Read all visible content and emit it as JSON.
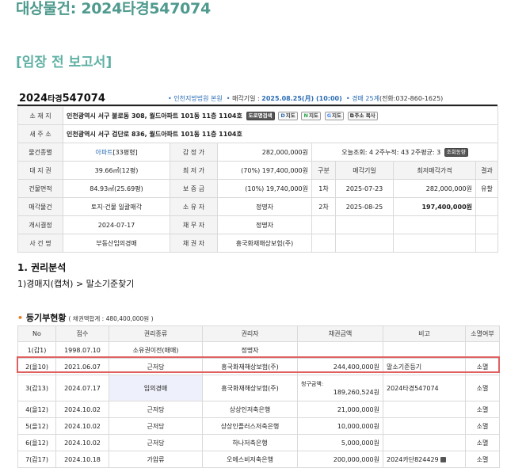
{
  "header": {
    "main_title": "대상물건: 2024타경547074",
    "report_title": "[임장 전 보고서]"
  },
  "case": {
    "year": "2024",
    "type": "타경",
    "number": "547074",
    "court": "인천지방법원 본원",
    "sale_date_label": "매각기일 : ",
    "sale_date": "2025.08.25(月) (10:00)",
    "dept_label": "경매 25계",
    "phone": "(전화:032-860-1625)"
  },
  "info": {
    "address_label": "소 재 지",
    "address": "인천광역시 서구 불로동 308, 월드아파트 101동 11층 1104호",
    "btn_road": "도로명검색",
    "btn_map_daum": "지도",
    "btn_map_naver": "지도",
    "btn_map_google": "지도",
    "btn_copy": "주소 복사",
    "new_address_label": "새 주 소",
    "new_address": "인천광역시 서구 검단로 836, 월드아파트 101동 11층 1104호",
    "kind_label": "물건종별",
    "kind": "아파트",
    "kind_size": "[33평형]",
    "appraisal_label": "감 정 가",
    "appraisal": "282,000,000원",
    "views": "오늘조회: 4  2주누적: 43  2주평균: 3",
    "views_btn": "조회동향",
    "land_label": "대 지 권",
    "land": "39.66㎡(12평)",
    "min_label": "최 저 가",
    "min_price": "(70%) 197,400,000원",
    "building_label": "건물면적",
    "building": "84.93㎡(25.69평)",
    "deposit_label": "보 증 금",
    "deposit": "(10%) 19,740,000원",
    "target_label": "매각물건",
    "target": "토지·건물 일괄매각",
    "owner_label": "소 유 자",
    "owner": "정명자",
    "start_label": "개시결정",
    "start_date": "2024-07-17",
    "debtor_label": "채 무 자",
    "debtor": "정명자",
    "case_name_label": "사 건 명",
    "case_name": "부동산임의경매",
    "creditor_label": "채 권 자",
    "creditor": "흥국화재해상보험(주)"
  },
  "history": {
    "headers": [
      "구분",
      "매각기일",
      "최저매각가격",
      "결과"
    ],
    "rows": [
      {
        "round": "1차",
        "date": "2025-07-23",
        "price": "282,000,000원",
        "result": "유찰"
      },
      {
        "round": "2차",
        "date": "2025-08-25",
        "price": "197,400,000원",
        "result": ""
      }
    ]
  },
  "rights": {
    "title": "1. 권리분석",
    "subtitle": "1)경매지(캡쳐) > 말소기준찾기"
  },
  "registry": {
    "title": "등기부현황",
    "total": "( 채권액합계 : 480,400,000원 )",
    "headers": [
      "No",
      "접수",
      "권리종류",
      "권리자",
      "채권금액",
      "비고",
      "소멸여부"
    ],
    "claim_label": "청구금액:",
    "rows": [
      {
        "no": "1(갑1)",
        "date": "1998.07.10",
        "type": "소유권이전(매매)",
        "holder": "정명자",
        "amount": "",
        "note": "",
        "status": ""
      },
      {
        "no": "2(을10)",
        "date": "2021.06.07",
        "type": "근저당",
        "holder": "흥국화재해상보험(주)",
        "amount": "244,400,000원",
        "note": "말소기준등기",
        "status": "소멸"
      },
      {
        "no": "3(갑13)",
        "date": "2024.07.17",
        "type": "임의경매",
        "holder": "흥국화재해상보험(주)",
        "amount": "189,260,524원",
        "note": "2024타경547074",
        "status": "소멸"
      },
      {
        "no": "4(을12)",
        "date": "2024.10.02",
        "type": "근저당",
        "holder": "상상인저축은행",
        "amount": "21,000,000원",
        "note": "",
        "status": "소멸"
      },
      {
        "no": "5(을12)",
        "date": "2024.10.02",
        "type": "근저당",
        "holder": "상상인플러스저축은행",
        "amount": "10,000,000원",
        "note": "",
        "status": "소멸"
      },
      {
        "no": "6(을12)",
        "date": "2024.10.02",
        "type": "근저당",
        "holder": "하나저축은행",
        "amount": "5,000,000원",
        "note": "",
        "status": "소멸"
      },
      {
        "no": "7(갑17)",
        "date": "2024.10.18",
        "type": "가압류",
        "holder": "오에스비저축은행",
        "amount": "200,000,000원",
        "note": "2024카단824429",
        "status": "소멸"
      }
    ]
  }
}
